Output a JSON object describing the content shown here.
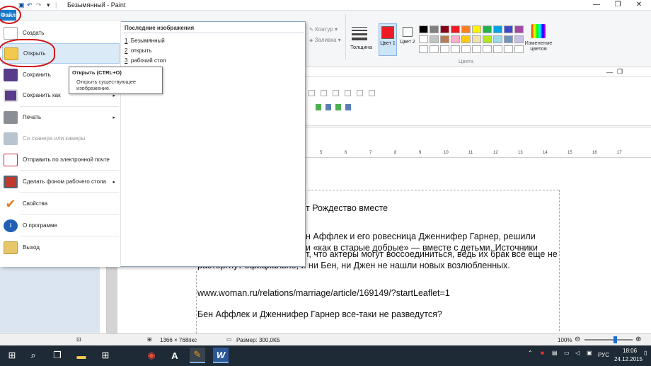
{
  "window": {
    "title": "Безымянный - Paint",
    "minimize": "—",
    "maximize": "❐",
    "close": "✕"
  },
  "ribbon": {
    "file_tab": "Файл",
    "kontur": "Контур",
    "zalivka": "Заливка",
    "tolshina": "Толщина",
    "color1": "Цвет 1",
    "color2": "Цвет 2",
    "change_colors": "Изменение цветов",
    "colors_group": "Цвета",
    "palette_row1": [
      "#000000",
      "#7f7f7f",
      "#880015",
      "#ed1c24",
      "#ff7f27",
      "#fff200",
      "#22b14c",
      "#00a2e8",
      "#3f48cc",
      "#a349a4"
    ],
    "palette_row2": [
      "#ffffff",
      "#c3c3c3",
      "#b97a57",
      "#ffaec9",
      "#ffc90e",
      "#efe4b0",
      "#b5e61d",
      "#99d9ea",
      "#7092be",
      "#c8bfe7"
    ],
    "color1_value": "#ed1c24",
    "color2_value": "#ffffff"
  },
  "file_menu": {
    "items": [
      {
        "label": "Создать",
        "icon": "new-icon"
      },
      {
        "label": "Открыть",
        "icon": "open-folder-icon"
      },
      {
        "label": "Сохранить",
        "icon": "save-icon"
      },
      {
        "label": "Сохранить как",
        "icon": "save-as-icon",
        "arrow": "▸"
      },
      {
        "label": "Печать",
        "icon": "print-icon",
        "arrow": "▸"
      },
      {
        "label": "Со сканера или камеры",
        "icon": "scanner-icon"
      },
      {
        "label": "Отправить по электронной почте",
        "icon": "email-icon"
      },
      {
        "label": "Сделать фоном рабочего стола",
        "icon": "desktop-background-icon",
        "arrow": "▸"
      },
      {
        "label": "Свойства",
        "icon": "checkmark-icon"
      },
      {
        "label": "О программе",
        "icon": "info-icon"
      },
      {
        "label": "Выход",
        "icon": "exit-icon"
      }
    ],
    "recent_title": "Последние изображения",
    "recent": [
      {
        "num": "1",
        "name": "Безымянный"
      },
      {
        "num": "2",
        "name": "открыть"
      },
      {
        "num": "3",
        "name": "рабочий стол"
      }
    ]
  },
  "tooltip": {
    "title": "Открыть (CTRL+O)",
    "body": "Открыть существующее изображение."
  },
  "document": {
    "line1": "т Рождество вместе",
    "line2": "н Аффлек и его ровесница Дженнифер Гарнер, решили",
    "line3": "и «как в старые добрые» — вместе с детьми. Источники",
    "line4": "т, что актеры могут воссоединиться, ведь их брак все еще не",
    "line5": "расторгнут официально, и ни Бен, ни Джен не нашли новых возлюбленных.",
    "link": "www.woman.ru/relations/marriage/article/169149/?startLeaflet=1",
    "heading": "Бен Аффлек и Дженнифер Гарнер все-таки не разведутся?",
    "ruler": [
      "5",
      "6",
      "7",
      "8",
      "9",
      "10",
      "11",
      "12",
      "13",
      "14",
      "15",
      "16",
      "17"
    ]
  },
  "statusbar": {
    "dimensions": "1366 × 768пкс",
    "size": "Размер: 300,0КБ",
    "zoom": "100%",
    "zoom_level": 0.65
  },
  "taskbar": {
    "language": "РУС",
    "time": "18:06",
    "date": "24.12.2015"
  }
}
